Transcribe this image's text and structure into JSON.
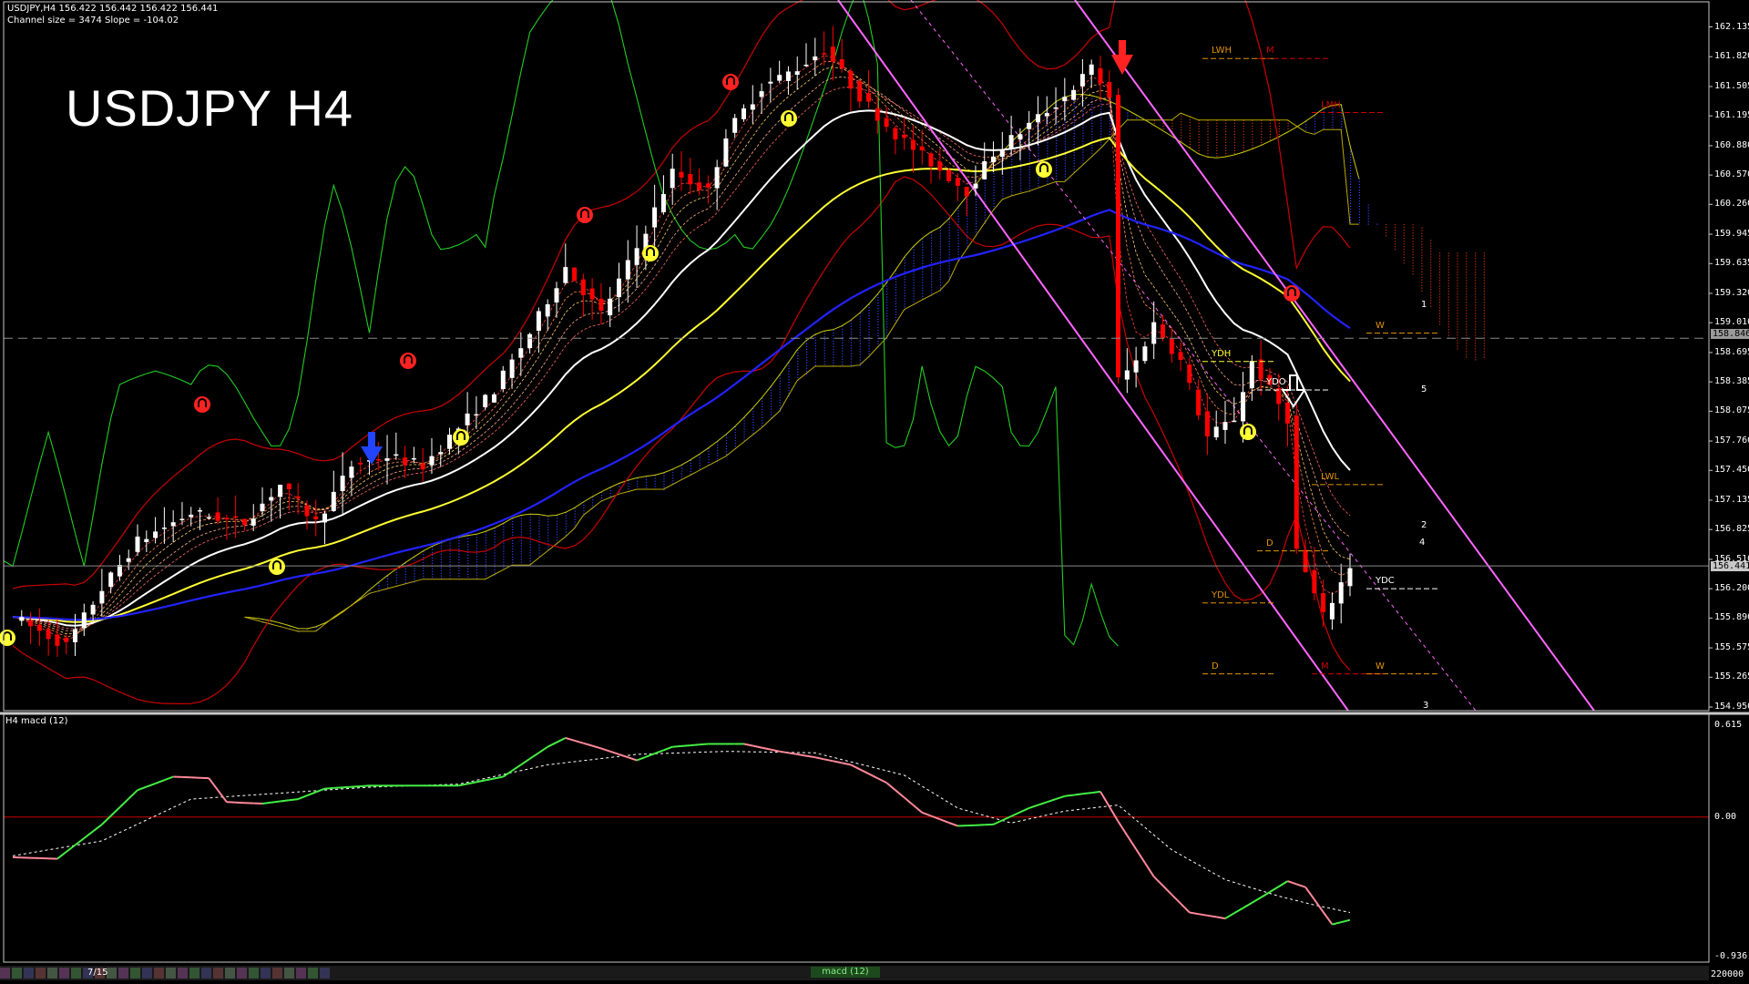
{
  "header": {
    "symbol_line": "USDJPY,H4  156.422 156.442 156.422 156.441",
    "channel_line": "Channel size = 3474 Slope = -104.02"
  },
  "title": "USDJPY H4",
  "macd_header": "H4  macd (12)",
  "colors": {
    "background": "#000000",
    "frame": "#c8c8c8",
    "bull": "#ffffff",
    "bear": "#ff0000",
    "ema_slow": "#2222ff",
    "ma_yellow": "#ffff33",
    "ma_white": "#ffffff",
    "envelope": "#cc0000",
    "chikou": "#22cc22",
    "cloud": "#3344ff",
    "cloud_bear": "#cc3300",
    "channel": "#ff66ff",
    "macd_up": "#44ee44",
    "macd_down": "#ff8899",
    "zero_line": "#cc0000"
  },
  "chart_data": [
    {
      "type": "candlestick",
      "title": "USDJPY H4",
      "ylim": [
        154.95,
        162.265
      ],
      "y_ticks": [
        "162.135",
        "161.820",
        "161.505",
        "161.195",
        "160.880",
        "160.570",
        "160.260",
        "159.945",
        "159.635",
        "159.320",
        "159.010",
        "158.695",
        "158.385",
        "158.075",
        "157.760",
        "157.450",
        "157.135",
        "156.825",
        "156.510",
        "156.200",
        "155.890",
        "155.575",
        "155.265",
        "154.950"
      ],
      "current_price": "156.441",
      "reference_line": "158.846",
      "candles_count": 150,
      "close_path": [
        [
          0,
          155.9
        ],
        [
          6,
          155.6
        ],
        [
          10,
          156.2
        ],
        [
          14,
          156.7
        ],
        [
          20,
          157.0
        ],
        [
          26,
          156.9
        ],
        [
          30,
          157.3
        ],
        [
          34,
          156.9
        ],
        [
          38,
          157.5
        ],
        [
          42,
          157.6
        ],
        [
          46,
          157.5
        ],
        [
          50,
          157.9
        ],
        [
          54,
          158.3
        ],
        [
          58,
          158.9
        ],
        [
          62,
          159.6
        ],
        [
          66,
          159.1
        ],
        [
          70,
          159.8
        ],
        [
          74,
          160.6
        ],
        [
          78,
          160.4
        ],
        [
          80,
          161.0
        ],
        [
          84,
          161.5
        ],
        [
          88,
          161.7
        ],
        [
          91,
          161.9
        ],
        [
          95,
          161.4
        ],
        [
          99,
          161.0
        ],
        [
          103,
          160.7
        ],
        [
          107,
          160.4
        ],
        [
          110,
          160.8
        ],
        [
          114,
          161.1
        ],
        [
          118,
          161.4
        ],
        [
          121,
          161.7
        ],
        [
          123,
          161.4
        ],
        [
          124,
          158.4
        ],
        [
          126,
          158.6
        ],
        [
          128,
          159.0
        ],
        [
          131,
          158.6
        ],
        [
          134,
          157.8
        ],
        [
          137,
          158.0
        ],
        [
          139,
          158.6
        ],
        [
          141,
          158.3
        ],
        [
          143,
          158.0
        ],
        [
          144,
          156.6
        ],
        [
          147,
          155.9
        ],
        [
          150,
          156.44
        ]
      ],
      "indicators": [
        "Ichimoku cloud",
        "Bollinger envelope",
        "Moving averages",
        "Chikou span",
        "Regression channel"
      ],
      "annotations": {
        "levels": [
          {
            "label": "LWH",
            "price": 161.8,
            "color": "#e39400"
          },
          {
            "label": "M",
            "price": 161.8,
            "color": "#cc0000"
          },
          {
            "label": "LMH",
            "price": 161.23,
            "color": "#cc0000"
          },
          {
            "label": "W",
            "price": 158.9,
            "color": "#e39400"
          },
          {
            "label": "YDH",
            "price": 158.6,
            "color": "#ffff33"
          },
          {
            "label": "YDO",
            "price": 158.3,
            "color": "#ffffff"
          },
          {
            "label": "LWL",
            "price": 157.3,
            "color": "#e39400"
          },
          {
            "label": "YDC",
            "price": 156.2,
            "color": "#ffffff"
          },
          {
            "label": "YDL",
            "price": 156.05,
            "color": "#e39400"
          },
          {
            "label": "D",
            "price": 156.6,
            "color": "#e39400"
          },
          {
            "label": "M",
            "price": 155.3,
            "color": "#cc0000"
          },
          {
            "label": "W",
            "price": 155.3,
            "color": "#e39400"
          },
          {
            "label": "D",
            "price": 155.3,
            "color": "#e39400"
          }
        ],
        "wave_labels": [
          "5",
          "1",
          "4",
          "2",
          "3"
        ]
      }
    },
    {
      "type": "line",
      "title": "H4  macd (12)",
      "ylim": [
        -0.936,
        0.615
      ],
      "y_ticks": [
        "0.615",
        "0.00",
        "-0.936"
      ],
      "zero": 0,
      "series": [
        {
          "role": "macd",
          "points": [
            [
              0,
              -0.27
            ],
            [
              5,
              -0.28
            ],
            [
              10,
              -0.05
            ],
            [
              14,
              0.18
            ],
            [
              18,
              0.27
            ],
            [
              22,
              0.26
            ],
            [
              24,
              0.1
            ],
            [
              28,
              0.09
            ],
            [
              32,
              0.12
            ],
            [
              35,
              0.19
            ],
            [
              40,
              0.21
            ],
            [
              45,
              0.21
            ],
            [
              50,
              0.21
            ],
            [
              55,
              0.27
            ],
            [
              60,
              0.47
            ],
            [
              62,
              0.53
            ],
            [
              66,
              0.46
            ],
            [
              70,
              0.38
            ],
            [
              74,
              0.47
            ],
            [
              78,
              0.49
            ],
            [
              82,
              0.49
            ],
            [
              86,
              0.44
            ],
            [
              90,
              0.4
            ],
            [
              94,
              0.35
            ],
            [
              98,
              0.23
            ],
            [
              102,
              0.03
            ],
            [
              106,
              -0.06
            ],
            [
              110,
              -0.05
            ],
            [
              114,
              0.06
            ],
            [
              118,
              0.14
            ],
            [
              122,
              0.17
            ],
            [
              124,
              -0.03
            ],
            [
              128,
              -0.4
            ],
            [
              132,
              -0.64
            ],
            [
              136,
              -0.68
            ],
            [
              140,
              -0.54
            ],
            [
              143,
              -0.43
            ],
            [
              145,
              -0.47
            ],
            [
              148,
              -0.72
            ],
            [
              150,
              -0.69
            ]
          ]
        },
        {
          "role": "signal",
          "points": [
            [
              0,
              -0.26
            ],
            [
              10,
              -0.16
            ],
            [
              20,
              0.12
            ],
            [
              30,
              0.16
            ],
            [
              40,
              0.2
            ],
            [
              50,
              0.22
            ],
            [
              60,
              0.35
            ],
            [
              70,
              0.42
            ],
            [
              80,
              0.44
            ],
            [
              90,
              0.43
            ],
            [
              100,
              0.28
            ],
            [
              106,
              0.06
            ],
            [
              112,
              -0.04
            ],
            [
              118,
              0.04
            ],
            [
              124,
              0.08
            ],
            [
              130,
              -0.22
            ],
            [
              136,
              -0.42
            ],
            [
              142,
              -0.53
            ],
            [
              146,
              -0.59
            ],
            [
              150,
              -0.64
            ]
          ]
        }
      ]
    }
  ],
  "bottom_bar": {
    "scroll_label": "7/15",
    "indicator_tab": "macd (12)",
    "volume_tick": "220000"
  }
}
